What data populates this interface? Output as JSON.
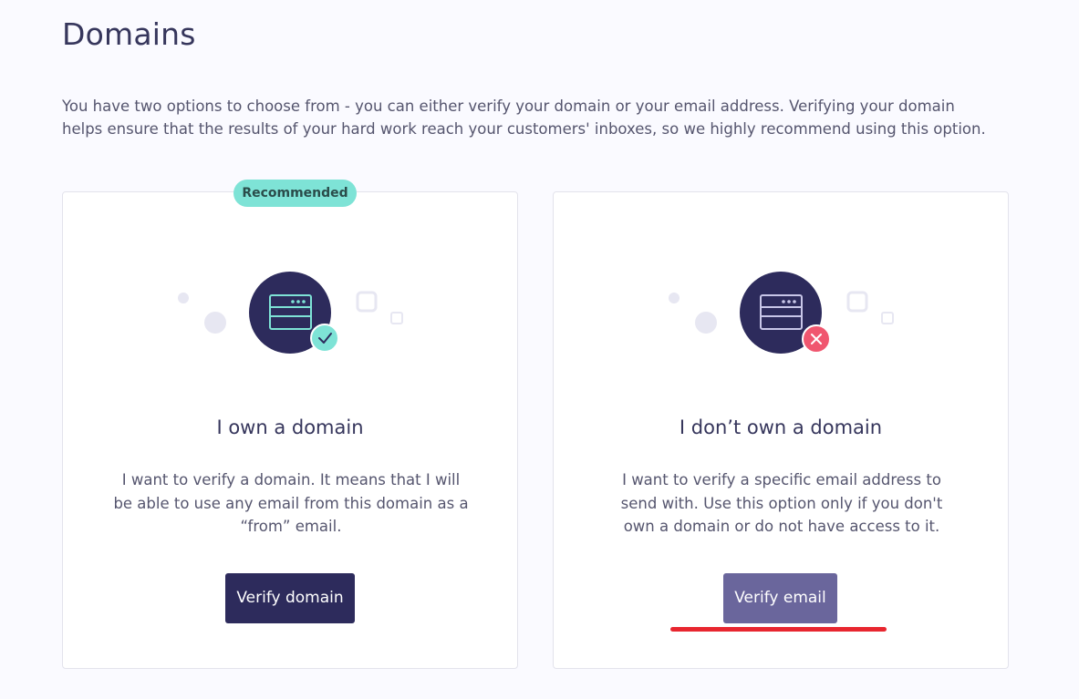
{
  "page": {
    "title": "Domains",
    "intro": "You have two options to choose from - you can either verify your domain or your email address. Verifying your domain helps ensure that the results of your hard work reach your customers' inboxes, so we highly recommend using this option."
  },
  "cards": [
    {
      "badge": "Recommended",
      "title": "I own a domain",
      "description": "I want to verify a domain. It means that I will be able to use any email from this domain as a “from” email.",
      "button_label": "Verify domain",
      "icon": "browser-window-icon",
      "status_icon": "check-icon",
      "status_color": "#7ee3d6"
    },
    {
      "title": "I don’t own a domain",
      "description": "I want to verify a specific email address to send with. Use this option only if you don't own a domain or do not have access to it.",
      "button_label": "Verify email",
      "icon": "browser-window-icon",
      "status_icon": "close-icon",
      "status_color": "#f0566f"
    }
  ],
  "colors": {
    "primary": "#2d2b5c",
    "secondary_button": "#6a669c",
    "badge": "#7ee3d6",
    "error": "#f0566f",
    "annotation": "#e8262f"
  }
}
